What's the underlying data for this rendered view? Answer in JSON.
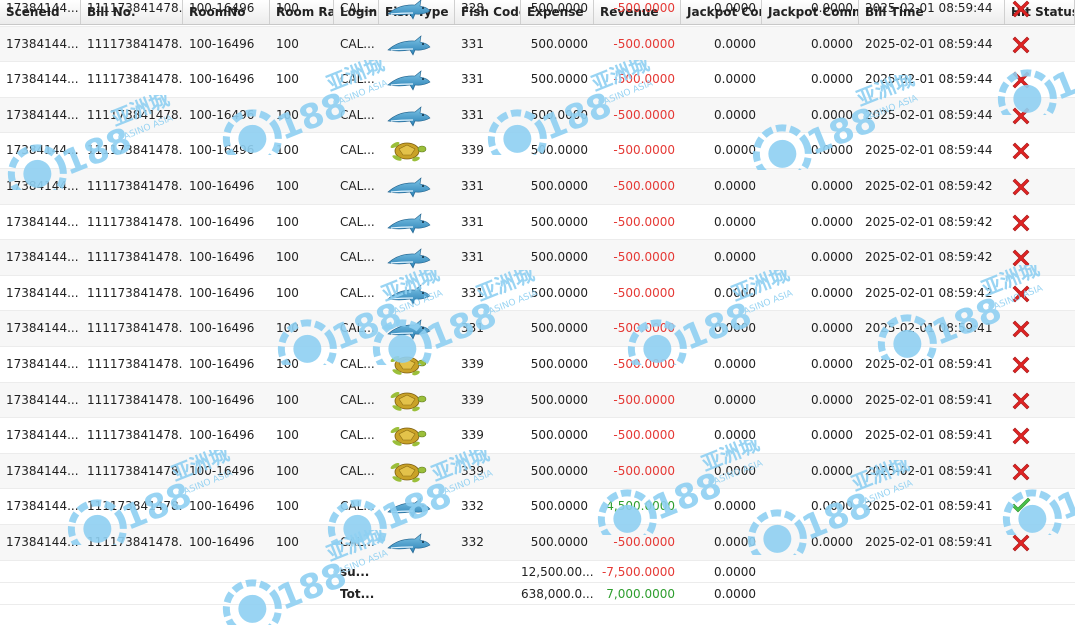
{
  "columns": [
    {
      "key": "scene",
      "label": "SceneId"
    },
    {
      "key": "bill",
      "label": "Bill No."
    },
    {
      "key": "room",
      "label": "RoomNo"
    },
    {
      "key": "rate",
      "label": "Room Rat"
    },
    {
      "key": "login",
      "label": "Login"
    },
    {
      "key": "fish",
      "label": "Fish Type"
    },
    {
      "key": "code",
      "label": "Fish Code"
    },
    {
      "key": "expense",
      "label": "Expense"
    },
    {
      "key": "revenue",
      "label": "Revenue"
    },
    {
      "key": "jpc",
      "label": "Jackpot Con"
    },
    {
      "key": "jpcm",
      "label": "Jackpot Comm"
    },
    {
      "key": "time",
      "label": "Bill Time"
    },
    {
      "key": "hit",
      "label": "Hit Status"
    }
  ],
  "rows": [
    {
      "scene": "17384144...",
      "bill": "111173841478...",
      "room": "100-16496",
      "rate": "100",
      "login": "CAL...",
      "fish": "shark-icon",
      "code": "328",
      "expense": "500.0000",
      "revenue": "-500.0000",
      "jpc": "0.0000",
      "jpcm": "0.0000",
      "time": "2025-02-01 08:59:44",
      "hit": "miss"
    },
    {
      "scene": "17384144...",
      "bill": "111173841478...",
      "room": "100-16496",
      "rate": "100",
      "login": "CAL...",
      "fish": "shark-icon",
      "code": "331",
      "expense": "500.0000",
      "revenue": "-500.0000",
      "jpc": "0.0000",
      "jpcm": "0.0000",
      "time": "2025-02-01 08:59:44",
      "hit": "miss"
    },
    {
      "scene": "17384144...",
      "bill": "111173841478...",
      "room": "100-16496",
      "rate": "100",
      "login": "CAL...",
      "fish": "shark-icon",
      "code": "331",
      "expense": "500.0000",
      "revenue": "-500.0000",
      "jpc": "0.0000",
      "jpcm": "0.0000",
      "time": "2025-02-01 08:59:44",
      "hit": "miss"
    },
    {
      "scene": "17384144...",
      "bill": "111173841478...",
      "room": "100-16496",
      "rate": "100",
      "login": "CAL...",
      "fish": "shark-icon",
      "code": "331",
      "expense": "500.0000",
      "revenue": "-500.0000",
      "jpc": "0.0000",
      "jpcm": "0.0000",
      "time": "2025-02-01 08:59:44",
      "hit": "miss"
    },
    {
      "scene": "17384144...",
      "bill": "111173841478...",
      "room": "100-16496",
      "rate": "100",
      "login": "CAL...",
      "fish": "turtle-icon",
      "code": "339",
      "expense": "500.0000",
      "revenue": "-500.0000",
      "jpc": "0.0000",
      "jpcm": "0.0000",
      "time": "2025-02-01 08:59:44",
      "hit": "miss"
    },
    {
      "scene": "17384144...",
      "bill": "111173841478...",
      "room": "100-16496",
      "rate": "100",
      "login": "CAL...",
      "fish": "shark-icon",
      "code": "331",
      "expense": "500.0000",
      "revenue": "-500.0000",
      "jpc": "0.0000",
      "jpcm": "0.0000",
      "time": "2025-02-01 08:59:42",
      "hit": "miss"
    },
    {
      "scene": "17384144...",
      "bill": "111173841478...",
      "room": "100-16496",
      "rate": "100",
      "login": "CAL...",
      "fish": "shark-icon",
      "code": "331",
      "expense": "500.0000",
      "revenue": "-500.0000",
      "jpc": "0.0000",
      "jpcm": "0.0000",
      "time": "2025-02-01 08:59:42",
      "hit": "miss"
    },
    {
      "scene": "17384144...",
      "bill": "111173841478...",
      "room": "100-16496",
      "rate": "100",
      "login": "CAL...",
      "fish": "shark-icon",
      "code": "331",
      "expense": "500.0000",
      "revenue": "-500.0000",
      "jpc": "0.0000",
      "jpcm": "0.0000",
      "time": "2025-02-01 08:59:42",
      "hit": "miss"
    },
    {
      "scene": "17384144...",
      "bill": "111173841478...",
      "room": "100-16496",
      "rate": "100",
      "login": "CAL...",
      "fish": "shark-icon",
      "code": "331",
      "expense": "500.0000",
      "revenue": "-500.0000",
      "jpc": "0.0000",
      "jpcm": "0.0000",
      "time": "2025-02-01 08:59:42",
      "hit": "miss"
    },
    {
      "scene": "17384144...",
      "bill": "111173841478...",
      "room": "100-16496",
      "rate": "100",
      "login": "CAL...",
      "fish": "shark-icon",
      "code": "331",
      "expense": "500.0000",
      "revenue": "-500.0000",
      "jpc": "0.0000",
      "jpcm": "0.0000",
      "time": "2025-02-01 08:59:41",
      "hit": "miss"
    },
    {
      "scene": "17384144...",
      "bill": "111173841478...",
      "room": "100-16496",
      "rate": "100",
      "login": "CAL...",
      "fish": "turtle-icon",
      "code": "339",
      "expense": "500.0000",
      "revenue": "-500.0000",
      "jpc": "0.0000",
      "jpcm": "0.0000",
      "time": "2025-02-01 08:59:41",
      "hit": "miss"
    },
    {
      "scene": "17384144...",
      "bill": "111173841478...",
      "room": "100-16496",
      "rate": "100",
      "login": "CAL...",
      "fish": "turtle-icon",
      "code": "339",
      "expense": "500.0000",
      "revenue": "-500.0000",
      "jpc": "0.0000",
      "jpcm": "0.0000",
      "time": "2025-02-01 08:59:41",
      "hit": "miss"
    },
    {
      "scene": "17384144...",
      "bill": "111173841478...",
      "room": "100-16496",
      "rate": "100",
      "login": "CAL...",
      "fish": "turtle-icon",
      "code": "339",
      "expense": "500.0000",
      "revenue": "-500.0000",
      "jpc": "0.0000",
      "jpcm": "0.0000",
      "time": "2025-02-01 08:59:41",
      "hit": "miss"
    },
    {
      "scene": "17384144...",
      "bill": "111173841478...",
      "room": "100-16496",
      "rate": "100",
      "login": "CAL...",
      "fish": "turtle-icon",
      "code": "339",
      "expense": "500.0000",
      "revenue": "-500.0000",
      "jpc": "0.0000",
      "jpcm": "0.0000",
      "time": "2025-02-01 08:59:41",
      "hit": "miss"
    },
    {
      "scene": "17384144...",
      "bill": "111173841478...",
      "room": "100-16496",
      "rate": "100",
      "login": "CAL...",
      "fish": "shark-icon",
      "code": "332",
      "expense": "500.0000",
      "revenue": "4,500.0000",
      "jpc": "0.0000",
      "jpcm": "0.0000",
      "time": "2025-02-01 08:59:41",
      "hit": "hit"
    },
    {
      "scene": "17384144...",
      "bill": "111173841478...",
      "room": "100-16496",
      "rate": "100",
      "login": "CAL...",
      "fish": "shark-icon",
      "code": "332",
      "expense": "500.0000",
      "revenue": "-500.0000",
      "jpc": "0.0000",
      "jpcm": "0.0000",
      "time": "2025-02-01 08:59:41",
      "hit": "miss"
    }
  ],
  "subtotal": {
    "label": "su...",
    "expense": "12,500.00...",
    "revenue": "-7,500.0000",
    "jpc": "0.0000"
  },
  "total": {
    "label": "Tot...",
    "expense": "638,000.0...",
    "revenue": "7,000.0000",
    "jpc": "0.0000"
  },
  "colors": {
    "negative": "#e53935",
    "positive": "#2e9e2e",
    "watermark": "#8fd0f2"
  },
  "watermark": {
    "brand": "188",
    "cn": "亚洲城",
    "en": "CASINO ASIA"
  }
}
